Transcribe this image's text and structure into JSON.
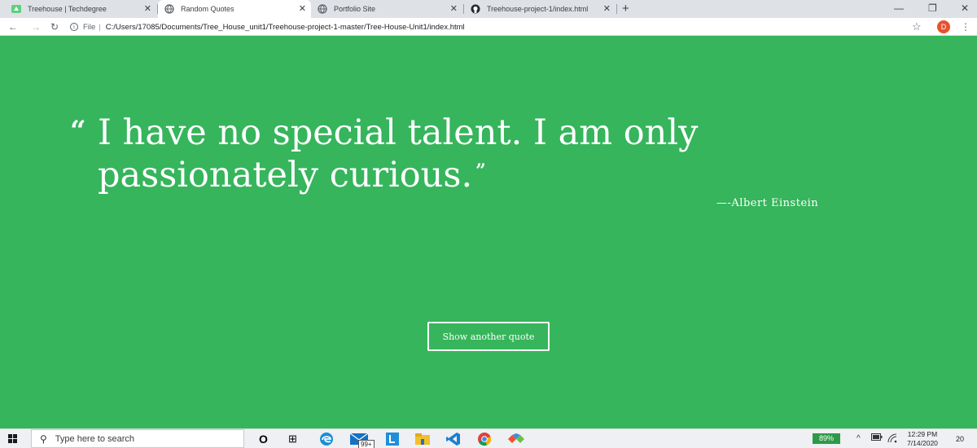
{
  "browser": {
    "tabs": [
      {
        "title": "Treehouse | Techdegree",
        "close": "✕"
      },
      {
        "title": "Random Quotes",
        "close": "✕"
      },
      {
        "title": "Portfolio Site",
        "close": "✕"
      },
      {
        "title": "Treehouse-project-1/index.html",
        "close": "✕"
      }
    ],
    "new_tab": "+",
    "window_controls": {
      "minimize": "—",
      "restore": "❐",
      "close": "✕"
    },
    "nav": {
      "back": "←",
      "forward": "→",
      "reload": "↻"
    },
    "address": {
      "info": "i",
      "scheme": "File",
      "separator": "|",
      "url": "C:/Users/17085/Documents/Tree_House_unit1/Treehouse-project-1-master/Tree-House-Unit1/index.html"
    },
    "bookmark": "☆",
    "profile_initial": "D",
    "menu": "⋮"
  },
  "page": {
    "quote_open": "“",
    "quote_text": "I have no special talent. I am only passionately curious.",
    "quote_close": "”",
    "source": "—-Albert Einstein",
    "button_label": "Show another quote",
    "background": "#36b55c"
  },
  "taskbar": {
    "search_placeholder": "Type here to search",
    "search_icon": "⚲",
    "cortana": "O",
    "task_view": "⊞",
    "mail_badge": "99+",
    "battery": "89%",
    "time": "12:29 PM",
    "date": "7/14/2020",
    "notifications": "20",
    "tray_chevron": "^"
  }
}
